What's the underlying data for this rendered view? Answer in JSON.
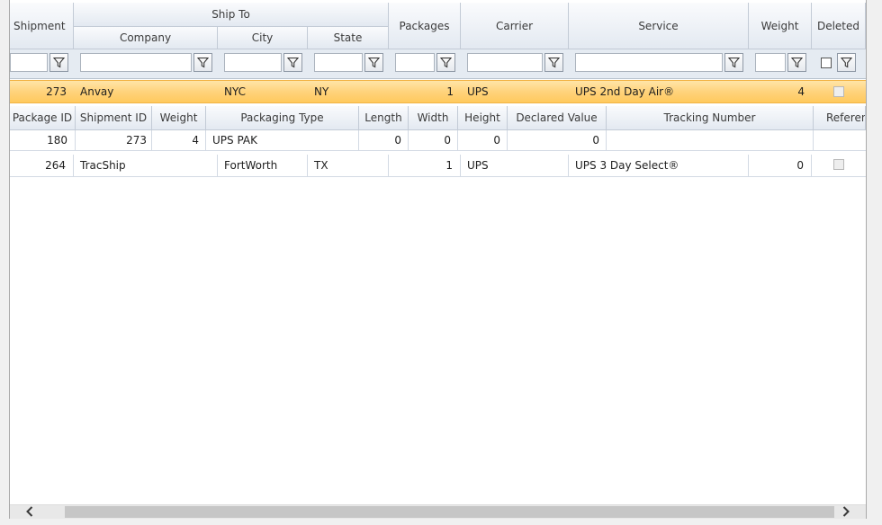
{
  "columns": {
    "group_ship_to": "Ship To",
    "shipment": "Shipment",
    "company": "Company",
    "city": "City",
    "state": "State",
    "packages": "Packages",
    "carrier": "Carrier",
    "service": "Service",
    "weight": "Weight",
    "deleted": "Deleted"
  },
  "filter": {
    "icon": "funnel-icon"
  },
  "rows": [
    {
      "shipment": "273",
      "company": "Anvay",
      "city": "NYC",
      "state": "NY",
      "packages": "1",
      "carrier": "UPS",
      "service": "UPS 2nd Day Air®",
      "weight": "4",
      "deleted": false
    },
    {
      "shipment": "264",
      "company": "TracShip",
      "city": "FortWorth",
      "state": "TX",
      "packages": "1",
      "carrier": "UPS",
      "service": "UPS 3 Day Select®",
      "weight": "0",
      "deleted": false
    }
  ],
  "detail": {
    "columns": {
      "package_id": "Package ID",
      "shipment_id": "Shipment ID",
      "weight": "Weight",
      "packaging_type": "Packaging Type",
      "length": "Length",
      "width": "Width",
      "height": "Height",
      "declared_value": "Declared Value",
      "tracking_number": "Tracking Number",
      "reference": "Referen"
    },
    "rows": [
      {
        "package_id": "180",
        "shipment_id": "273",
        "weight": "4",
        "packaging_type": "UPS PAK",
        "length": "0",
        "width": "0",
        "height": "0",
        "declared_value": "0",
        "tracking_number": "",
        "reference": ""
      }
    ]
  },
  "scrollbar": {
    "left_icon": "chevron-left-icon",
    "right_icon": "chevron-right-icon"
  },
  "colors": {
    "selected_row": "#ffd37c",
    "header": "#e3e9f1"
  }
}
